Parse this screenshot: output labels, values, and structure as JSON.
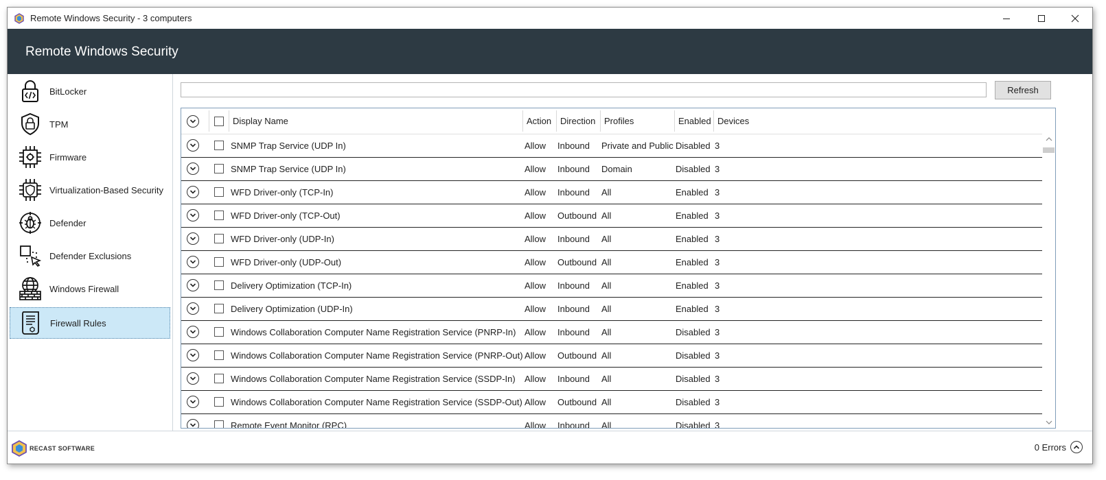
{
  "window": {
    "title": "Remote Windows Security - 3 computers",
    "minimize_icon": "minimize-icon",
    "maximize_icon": "maximize-icon",
    "close_icon": "close-icon"
  },
  "header": {
    "title": "Remote Windows Security",
    "background": "#2d3a43"
  },
  "sidebar": {
    "items": [
      {
        "label": "BitLocker",
        "icon": "lock-code-icon"
      },
      {
        "label": "TPM",
        "icon": "shield-lock-icon"
      },
      {
        "label": "Firmware",
        "icon": "chip-gear-icon"
      },
      {
        "label": "Virtualization-Based Security",
        "icon": "chip-shield-icon"
      },
      {
        "label": "Defender",
        "icon": "bug-target-icon"
      },
      {
        "label": "Defender Exclusions",
        "icon": "select-cursor-icon"
      },
      {
        "label": "Windows Firewall",
        "icon": "globe-wall-icon"
      },
      {
        "label": "Firewall Rules",
        "icon": "document-rules-icon",
        "selected": true
      }
    ],
    "selected_color": "#cce8f7"
  },
  "toolbar": {
    "search_value": "",
    "refresh_label": "Refresh"
  },
  "table": {
    "columns": {
      "display_name": "Display Name",
      "action": "Action",
      "direction": "Direction",
      "profiles": "Profiles",
      "enabled": "Enabled",
      "devices": "Devices"
    },
    "rows": [
      {
        "name": "SNMP Trap Service (UDP In)",
        "action": "Allow",
        "direction": "Inbound",
        "profiles": "Private and Public",
        "enabled": "Disabled",
        "devices": "3"
      },
      {
        "name": "SNMP Trap Service (UDP In)",
        "action": "Allow",
        "direction": "Inbound",
        "profiles": "Domain",
        "enabled": "Disabled",
        "devices": "3"
      },
      {
        "name": "WFD Driver-only (TCP-In)",
        "action": "Allow",
        "direction": "Inbound",
        "profiles": "All",
        "enabled": "Enabled",
        "devices": "3"
      },
      {
        "name": "WFD Driver-only (TCP-Out)",
        "action": "Allow",
        "direction": "Outbound",
        "profiles": "All",
        "enabled": "Enabled",
        "devices": "3"
      },
      {
        "name": "WFD Driver-only (UDP-In)",
        "action": "Allow",
        "direction": "Inbound",
        "profiles": "All",
        "enabled": "Enabled",
        "devices": "3"
      },
      {
        "name": "WFD Driver-only (UDP-Out)",
        "action": "Allow",
        "direction": "Outbound",
        "profiles": "All",
        "enabled": "Enabled",
        "devices": "3"
      },
      {
        "name": "Delivery Optimization (TCP-In)",
        "action": "Allow",
        "direction": "Inbound",
        "profiles": "All",
        "enabled": "Enabled",
        "devices": "3"
      },
      {
        "name": "Delivery Optimization (UDP-In)",
        "action": "Allow",
        "direction": "Inbound",
        "profiles": "All",
        "enabled": "Enabled",
        "devices": "3"
      },
      {
        "name": "Windows Collaboration Computer Name Registration Service (PNRP-In)",
        "action": "Allow",
        "direction": "Inbound",
        "profiles": "All",
        "enabled": "Disabled",
        "devices": "3"
      },
      {
        "name": "Windows Collaboration Computer Name Registration Service (PNRP-Out)",
        "action": "Allow",
        "direction": "Outbound",
        "profiles": "All",
        "enabled": "Disabled",
        "devices": "3"
      },
      {
        "name": "Windows Collaboration Computer Name Registration Service (SSDP-In)",
        "action": "Allow",
        "direction": "Inbound",
        "profiles": "All",
        "enabled": "Disabled",
        "devices": "3"
      },
      {
        "name": "Windows Collaboration Computer Name Registration Service (SSDP-Out)",
        "action": "Allow",
        "direction": "Outbound",
        "profiles": "All",
        "enabled": "Disabled",
        "devices": "3"
      },
      {
        "name": "Remote Event Monitor (RPC)",
        "action": "Allow",
        "direction": "Inbound",
        "profiles": "All",
        "enabled": "Disabled",
        "devices": "3"
      }
    ]
  },
  "footer": {
    "brand": "RECAST SOFTWARE",
    "errors": "0 Errors",
    "errors_icon": "chevron-up-circle-icon"
  }
}
